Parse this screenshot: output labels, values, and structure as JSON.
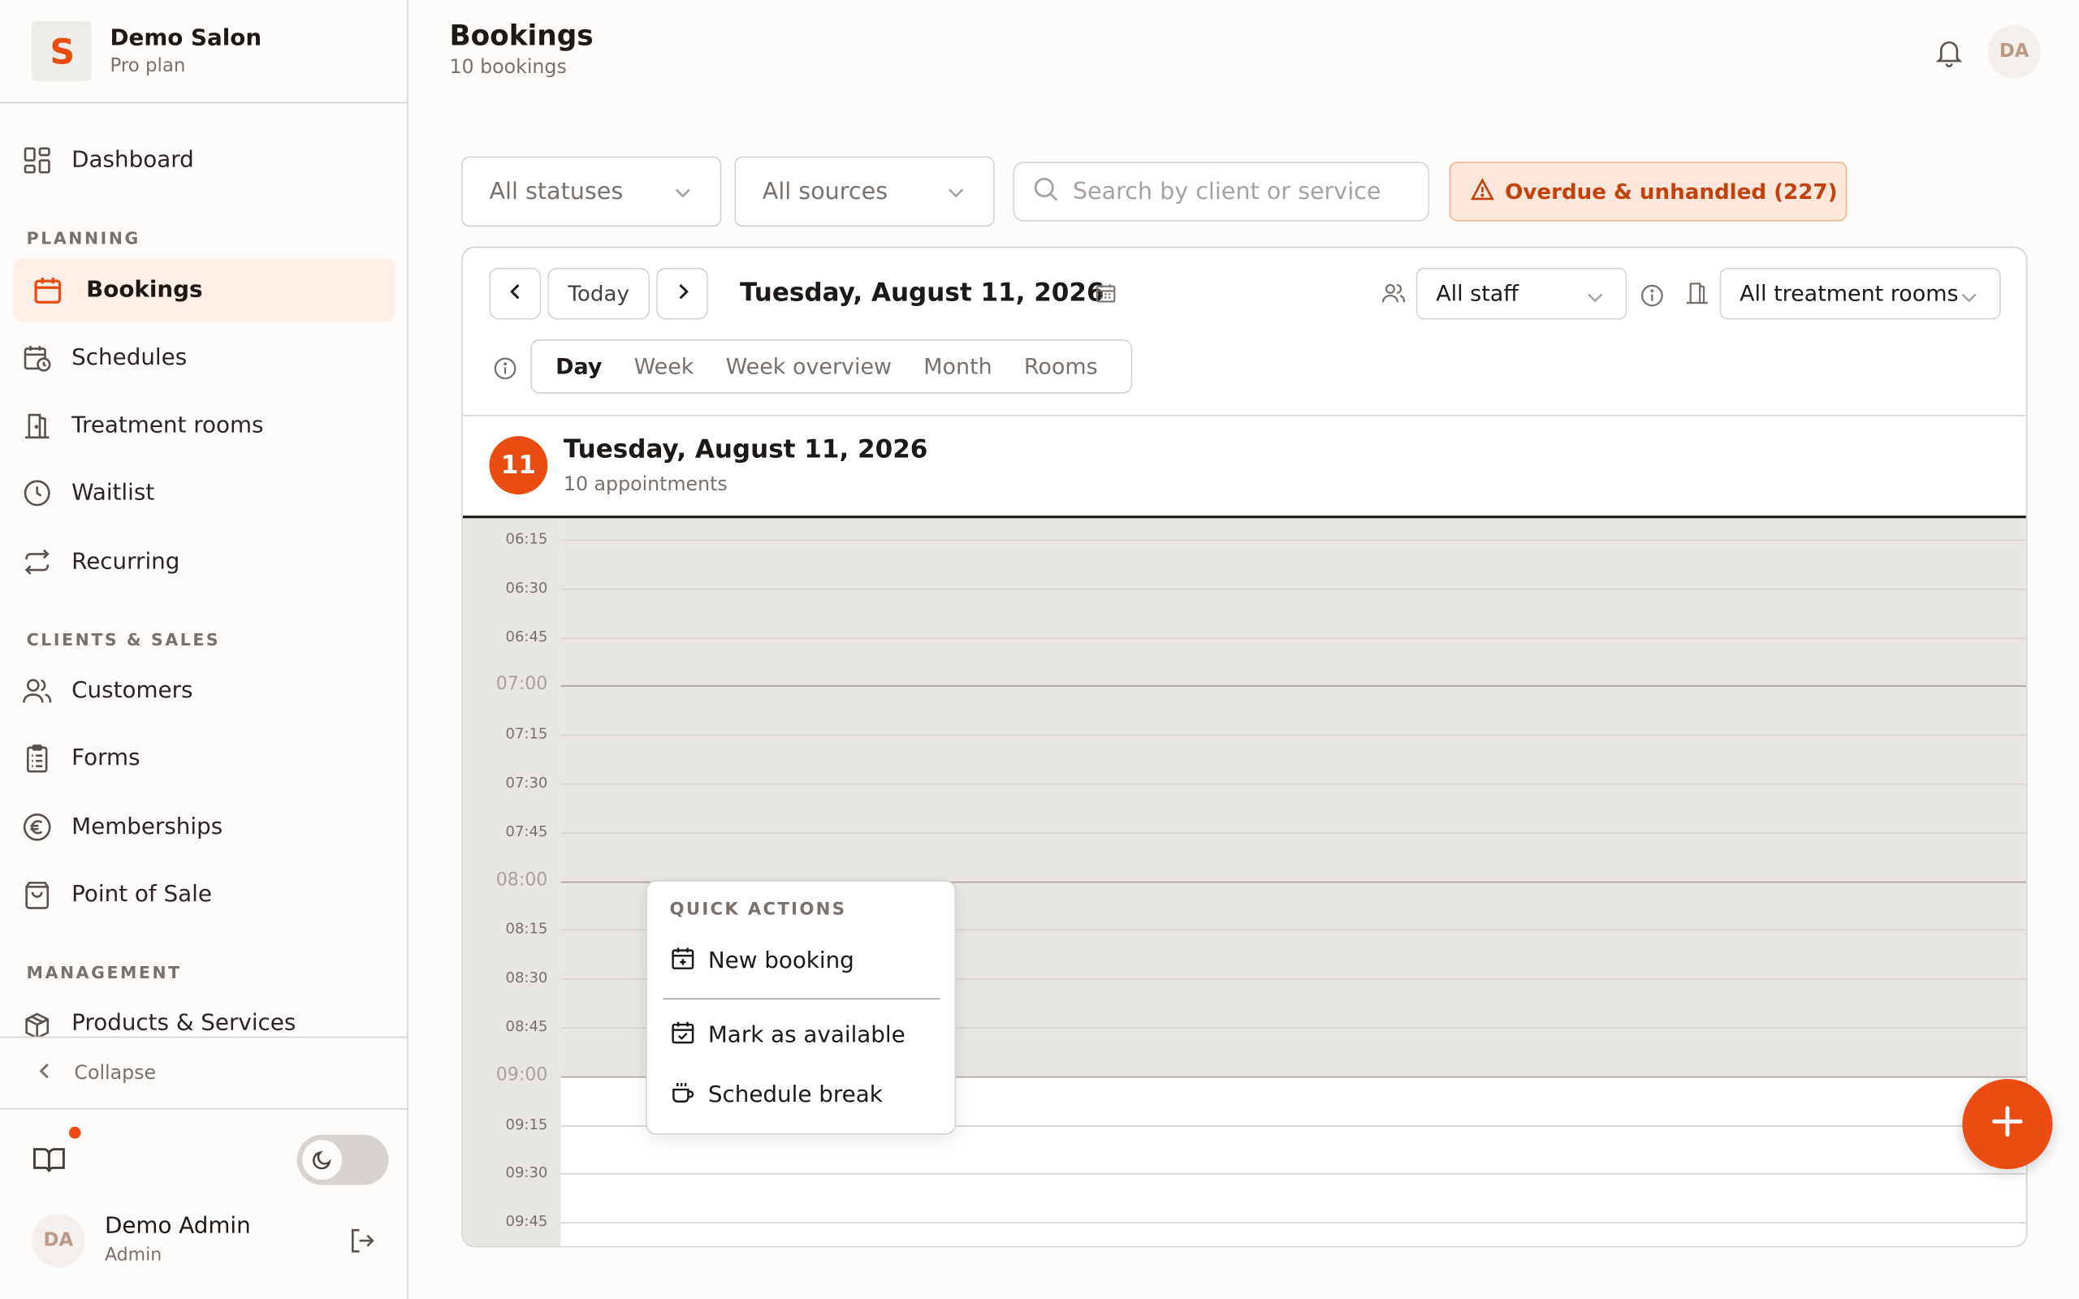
{
  "brand": {
    "name": "Demo Salon",
    "plan": "Pro plan",
    "logo_letter": "S",
    "accent": "#ea4c12"
  },
  "sidebar": {
    "items": [
      {
        "label": "Dashboard",
        "icon": "dashboard-grid-icon"
      },
      {
        "label": "Bookings",
        "icon": "calendar-icon",
        "active": true
      },
      {
        "label": "Schedules",
        "icon": "calendar-clock-icon"
      },
      {
        "label": "Treatment rooms",
        "icon": "door-icon"
      },
      {
        "label": "Waitlist",
        "icon": "clock-icon"
      },
      {
        "label": "Recurring",
        "icon": "repeat-icon"
      },
      {
        "label": "Customers",
        "icon": "users-icon"
      },
      {
        "label": "Forms",
        "icon": "clipboard-icon"
      },
      {
        "label": "Memberships",
        "icon": "euro-icon"
      },
      {
        "label": "Point of Sale",
        "icon": "shopping-bag-icon"
      },
      {
        "label": "Products & Services",
        "icon": "package-icon"
      }
    ],
    "sections": [
      "PLANNING",
      "CLIENTS & SALES",
      "MANAGEMENT"
    ],
    "collapse_label": "Collapse"
  },
  "user": {
    "initials": "DA",
    "name": "Demo Admin",
    "role": "Admin"
  },
  "header": {
    "title": "Bookings",
    "subtitle": "10 bookings",
    "avatar_initials": "DA"
  },
  "filters": {
    "status": "All statuses",
    "source": "All sources",
    "search_placeholder": "Search by client or service",
    "overdue_label": "Overdue & unhandled (227)"
  },
  "calendar": {
    "today_label": "Today",
    "date_title": "Tuesday, August 11, 2026",
    "staff_filter": "All staff",
    "room_filter": "All treatment rooms",
    "views": [
      "Day",
      "Week",
      "Week overview",
      "Month",
      "Rooms"
    ],
    "active_view": "Day",
    "day_number": "11",
    "day_title": "Tuesday, August 11, 2026",
    "day_subtitle": "10 appointments",
    "times": [
      "06:15",
      "06:30",
      "06:45",
      "07:00",
      "07:15",
      "07:30",
      "07:45",
      "08:00",
      "08:15",
      "08:30",
      "08:45",
      "09:00",
      "09:15",
      "09:30",
      "09:45"
    ]
  },
  "quick_actions": {
    "heading": "QUICK ACTIONS",
    "new_booking": "New booking",
    "mark_available": "Mark as available",
    "schedule_break": "Schedule break"
  }
}
